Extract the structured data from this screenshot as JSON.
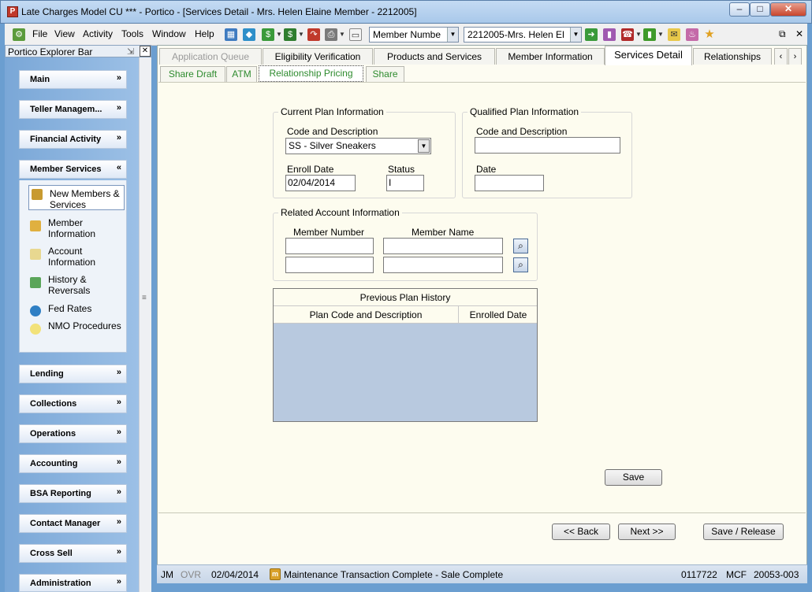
{
  "window": {
    "title": "Late Charges Model CU *** - Portico - [Services Detail - Mrs. Helen Elaine Member - 2212005]",
    "buttons": {
      "minimize": "–",
      "maximize": "□",
      "close": "✕"
    }
  },
  "menu": {
    "items": [
      "File",
      "View",
      "Activity",
      "Tools",
      "Window",
      "Help"
    ],
    "search_field": "Member Numbe",
    "member_select": "2212005-Mrs. Helen El",
    "right_controls": {
      "restore": "⧉",
      "close": "✕"
    }
  },
  "explorer": {
    "title": "Portico Explorer Bar",
    "groups_top": [
      {
        "label": "Main",
        "chevron": "»"
      },
      {
        "label": "Teller Managem...",
        "chevron": "»"
      },
      {
        "label": "Financial Activity",
        "chevron": "»"
      },
      {
        "label": "Member Services",
        "chevron": "«"
      }
    ],
    "member_services_items": [
      {
        "label": "New Members & Services",
        "icon": "new-members-icon"
      },
      {
        "label": "Member Information",
        "icon": "member-info-icon"
      },
      {
        "label": "Account Information",
        "icon": "account-info-icon"
      },
      {
        "label": "History & Reversals",
        "icon": "history-icon"
      },
      {
        "label": "Fed Rates",
        "icon": "globe-icon"
      },
      {
        "label": "NMO Procedures",
        "icon": "lightbulb-icon"
      }
    ],
    "groups_bottom": [
      {
        "label": "Lending",
        "chevron": "»"
      },
      {
        "label": "Collections",
        "chevron": "»"
      },
      {
        "label": "Operations",
        "chevron": "»"
      },
      {
        "label": "Accounting",
        "chevron": "»"
      },
      {
        "label": "BSA Reporting",
        "chevron": "»"
      },
      {
        "label": "Contact Manager",
        "chevron": "»"
      },
      {
        "label": "Cross Sell",
        "chevron": "»"
      },
      {
        "label": "Administration",
        "chevron": "»"
      }
    ]
  },
  "tabs": [
    {
      "label": "Application Queue"
    },
    {
      "label": "Eligibility Verification"
    },
    {
      "label": "Products and Services"
    },
    {
      "label": "Member Information"
    },
    {
      "label": "Services Detail"
    },
    {
      "label": "Relationships"
    }
  ],
  "tab_nav": {
    "prev": "‹",
    "next": "›"
  },
  "subtabs": [
    {
      "label": "Share Draft"
    },
    {
      "label": "ATM"
    },
    {
      "label": "Relationship Pricing"
    },
    {
      "label": "Share"
    }
  ],
  "current_plan": {
    "legend": "Current Plan Information",
    "code_label": "Code and Description",
    "code_value": "SS - Silver Sneakers",
    "enroll_label": "Enroll Date",
    "enroll_value": "02/04/2014",
    "status_label": "Status",
    "status_value": "I"
  },
  "qualified_plan": {
    "legend": "Qualified Plan Information",
    "code_label": "Code and Description",
    "code_value": "",
    "date_label": "Date",
    "date_value": ""
  },
  "related": {
    "legend": "Related Account Information",
    "number_label": "Member Number",
    "name_label": "Member Name",
    "rows": [
      {
        "number": "",
        "name": ""
      },
      {
        "number": "",
        "name": ""
      }
    ]
  },
  "history": {
    "caption": "Previous Plan History",
    "columns": [
      "Plan Code and Description",
      "Enrolled Date"
    ]
  },
  "buttons": {
    "save": "Save",
    "back": "<< Back",
    "next": "Next >>",
    "save_release": "Save / Release"
  },
  "status": {
    "user": "JM",
    "ovr": "OVR",
    "date": "02/04/2014",
    "icon_letter": "m",
    "message": "Maintenance Transaction Complete - Sale Complete",
    "num1": "0117722",
    "mcf": "MCF",
    "num2": "20053-003"
  }
}
